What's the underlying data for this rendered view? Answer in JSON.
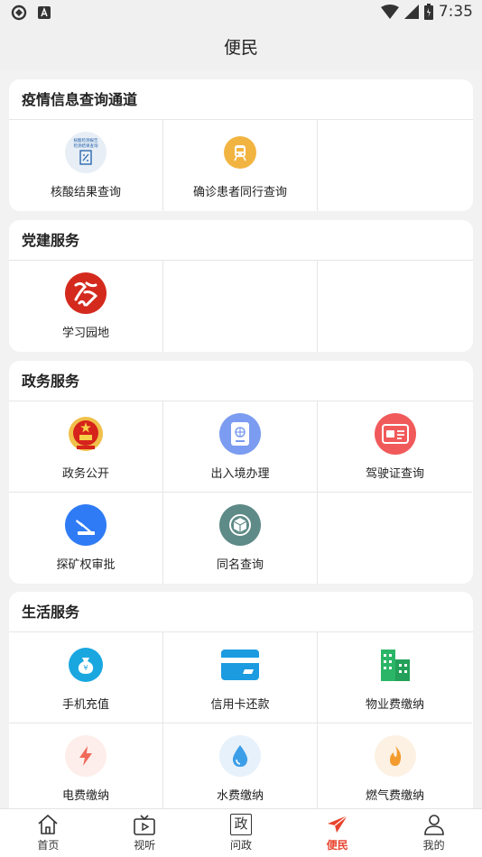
{
  "status_bar": {
    "time": "7:35"
  },
  "header": {
    "title": "便民"
  },
  "sections": [
    {
      "title": "疫情信息查询通道",
      "items": [
        {
          "label": "核酸结果查询",
          "icon": "nucleic-test-icon",
          "color": "#e7eef6",
          "icon_text": "核酸检测报告 检测结果查询"
        },
        {
          "label": "确诊患者同行查询",
          "icon": "train-icon",
          "color": "#f2b441"
        }
      ]
    },
    {
      "title": "党建服务",
      "items": [
        {
          "label": "学习园地",
          "icon": "study-logo-icon",
          "color": "#d42a1e"
        }
      ]
    },
    {
      "title": "政务服务",
      "items": [
        {
          "label": "政务公开",
          "icon": "national-emblem-icon",
          "color": "#d6231b"
        },
        {
          "label": "出入境办理",
          "icon": "passport-icon",
          "color": "#7b9cf0"
        },
        {
          "label": "驾驶证查询",
          "icon": "license-card-icon",
          "color": "#f15a5a"
        },
        {
          "label": "探矿权审批",
          "icon": "mining-icon",
          "color": "#2f7bf5"
        },
        {
          "label": "同名查询",
          "icon": "cube-icon",
          "color": "#5e8a87"
        }
      ]
    },
    {
      "title": "生活服务",
      "items": [
        {
          "label": "手机充值",
          "icon": "money-bag-icon",
          "color": "#1aa7e0"
        },
        {
          "label": "信用卡还款",
          "icon": "credit-card-icon",
          "color": "#1c9be0"
        },
        {
          "label": "物业费缴纳",
          "icon": "buildings-icon",
          "color": "#2bb566"
        },
        {
          "label": "电费缴纳",
          "icon": "lightning-icon",
          "color": "#f06a5a"
        },
        {
          "label": "水费缴纳",
          "icon": "water-drop-icon",
          "color": "#3d9ee8"
        },
        {
          "label": "燃气费缴纳",
          "icon": "flame-icon",
          "color": "#f39b2e"
        }
      ]
    }
  ],
  "tabbar": {
    "items": [
      {
        "label": "首页",
        "icon": "home-icon",
        "active": false
      },
      {
        "label": "视听",
        "icon": "tv-icon",
        "active": false
      },
      {
        "label": "问政",
        "icon": "zheng-icon",
        "active": false,
        "glyph": "政"
      },
      {
        "label": "便民",
        "icon": "paper-plane-icon",
        "active": true
      },
      {
        "label": "我的",
        "icon": "user-icon",
        "active": false
      }
    ],
    "active_color": "#e8432e"
  }
}
